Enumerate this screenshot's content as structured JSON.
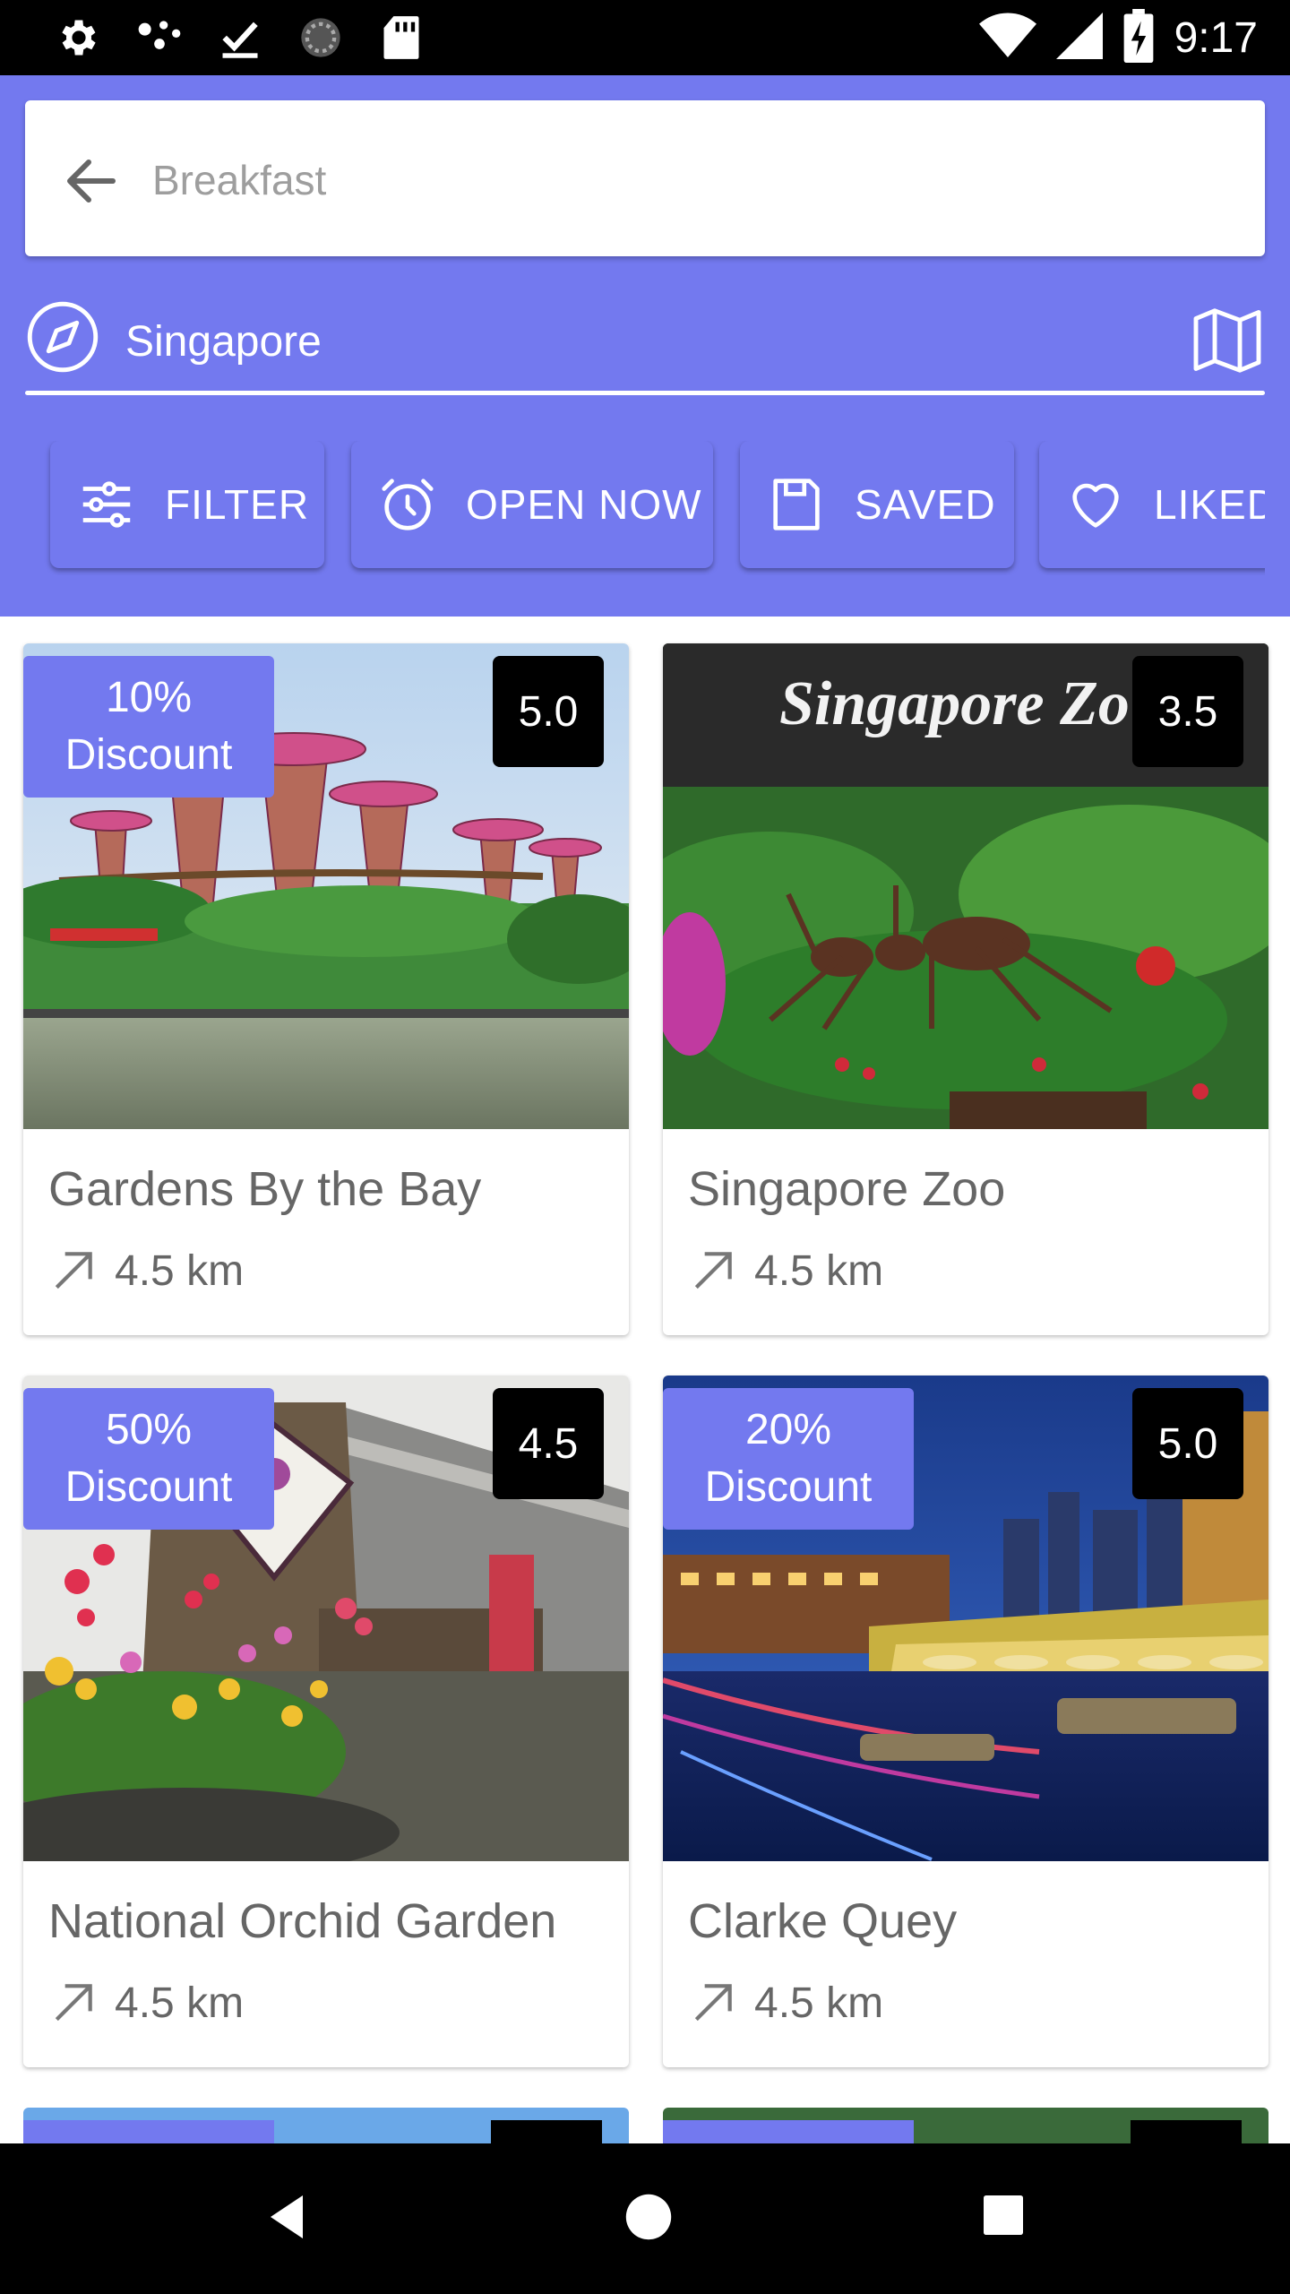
{
  "status_bar": {
    "time": "9:17"
  },
  "search": {
    "placeholder": "Breakfast"
  },
  "location": {
    "text": "Singapore"
  },
  "chips": [
    {
      "label": "FILTER",
      "icon": "tune-icon"
    },
    {
      "label": "OPEN NOW",
      "icon": "alarm-icon"
    },
    {
      "label": "SAVED",
      "icon": "save-icon"
    },
    {
      "label": "LIKED",
      "icon": "heart-icon"
    }
  ],
  "places": [
    {
      "name": "Gardens By the Bay",
      "distance": "4.5 km",
      "rating": "5.0",
      "discount_line1": "10%",
      "discount_line2": "Discount"
    },
    {
      "name": "Singapore Zoo",
      "distance": "4.5 km",
      "rating": "3.5",
      "sign_text": "Singapore Zo"
    },
    {
      "name": "National Orchid Garden",
      "distance": "4.5 km",
      "rating": "4.5",
      "discount_line1": "50%",
      "discount_line2": "Discount"
    },
    {
      "name": "Clarke Quey",
      "distance": "4.5 km",
      "rating": "5.0",
      "discount_line1": "20%",
      "discount_line2": "Discount"
    }
  ],
  "colors": {
    "primary": "#7379ef",
    "status_bar": "#000000"
  }
}
